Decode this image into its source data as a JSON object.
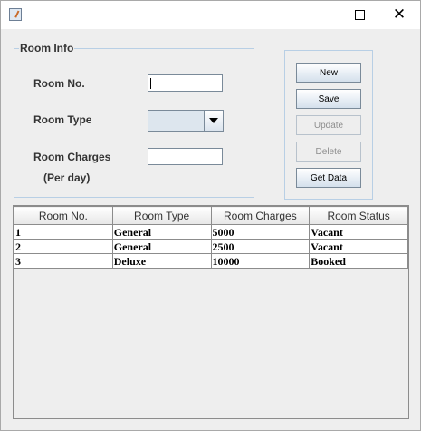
{
  "window": {
    "title": ""
  },
  "room_info": {
    "title": "Room Info",
    "room_no_label": "Room No.",
    "room_no_value": "",
    "room_type_label": "Room Type",
    "room_type_value": "",
    "room_charges_label": "Room Charges",
    "per_day_label": "(Per day)",
    "room_charges_value": ""
  },
  "buttons": {
    "new": "New",
    "save": "Save",
    "update": "Update",
    "delete": "Delete",
    "get_data": "Get Data"
  },
  "table": {
    "headers": [
      "Room No.",
      "Room Type",
      "Room Charges",
      "Room Status"
    ],
    "rows": [
      [
        "1",
        "General",
        "5000",
        "Vacant"
      ],
      [
        "2",
        "General",
        "2500",
        "Vacant"
      ],
      [
        "3",
        "Deluxe",
        "10000",
        "Booked"
      ]
    ]
  }
}
